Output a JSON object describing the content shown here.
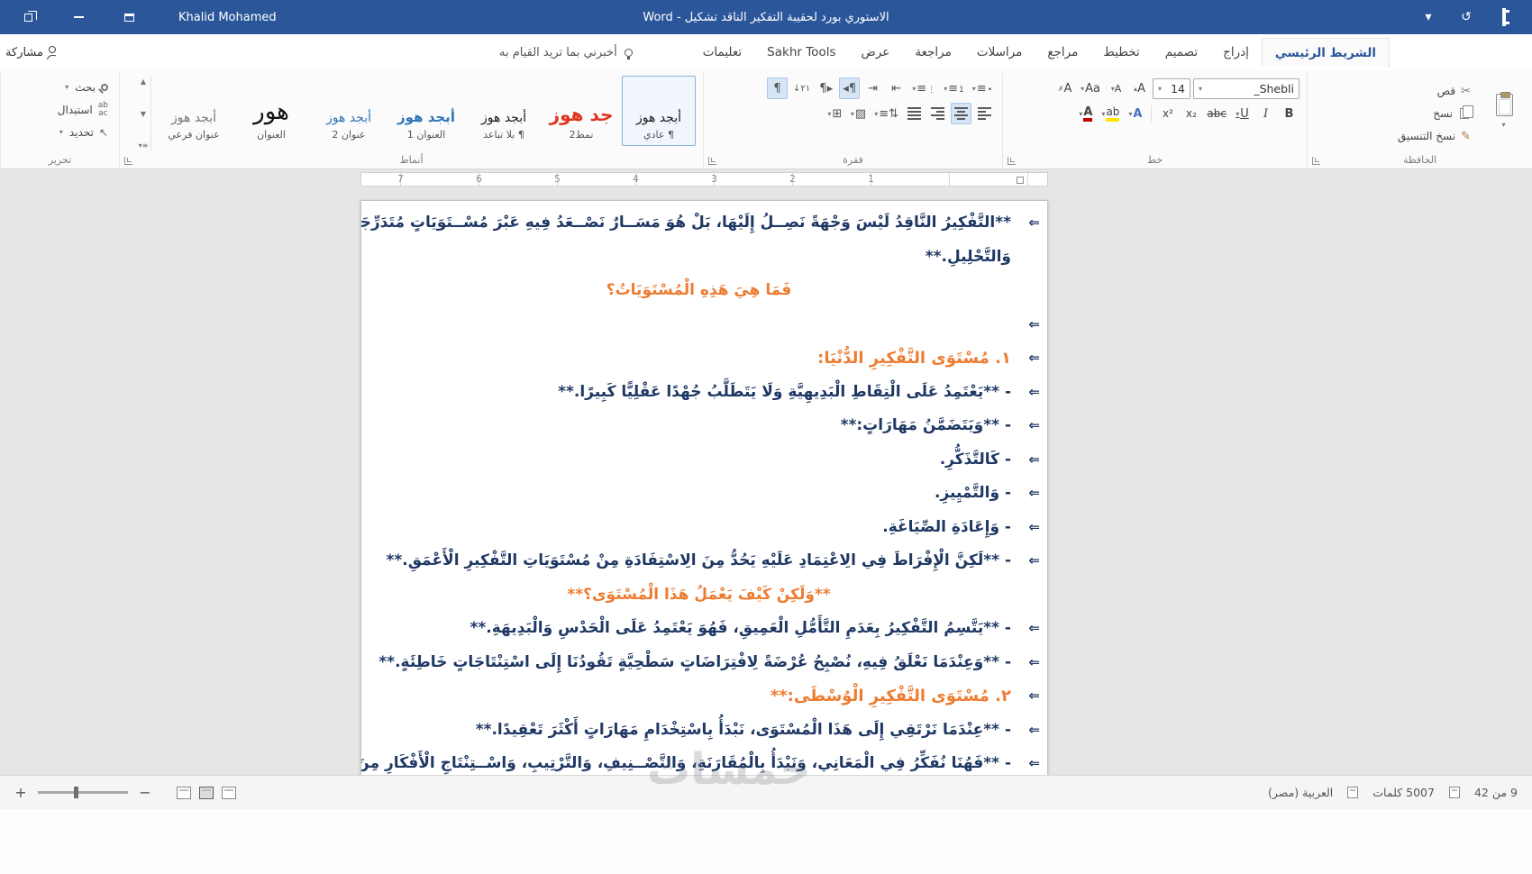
{
  "colors": {
    "titlebar": "#2b579a",
    "accent": "#2b579a",
    "heading_orange": "#ED7C31",
    "body_text": "#1F3864"
  },
  "titlebar": {
    "user_name": "Khalid Mohamed",
    "doc_title": "الاستوري بورد لحقيبة التفكير الناقد تشكيل - Word"
  },
  "tabs": {
    "share_label": "مشاركة",
    "tell_me": "أخبرني بما تريد القيام به",
    "items": [
      "الشريط الرئيسي",
      "إدراج",
      "تصميم",
      "تخطيط",
      "مراجع",
      "مراسلات",
      "مراجعة",
      "عرض",
      "Sakhr Tools",
      "تعليمات"
    ]
  },
  "ribbon": {
    "clipboard": {
      "label": "الحافظة",
      "cut": "قص",
      "copy": "نسخ",
      "format_painter": "نسخ التنسيق"
    },
    "font": {
      "label": "خط",
      "font_name": "_Shebli",
      "font_size": "14",
      "bold": "B",
      "italic": "I",
      "underline": "U",
      "strike": "abc",
      "subscript": "x₂",
      "superscript": "x²",
      "grow": "A",
      "shrink": "A",
      "change_case": "Aa",
      "clear": "A",
      "effects": "A",
      "highlight": "ab",
      "color": "A"
    },
    "paragraph": {
      "label": "فقرة"
    },
    "styles": {
      "label": "أنماط",
      "items": [
        {
          "preview": "أبجد هوز",
          "name": "¶ عادي"
        },
        {
          "preview": "جد هوز",
          "name": "نمط2"
        },
        {
          "preview": "أبجد هوز",
          "name": "¶ بلا تباعد"
        },
        {
          "preview": "أبجد هوز",
          "name": "العنوان 1"
        },
        {
          "preview": "أبجد هوز",
          "name": "عنوان 2"
        },
        {
          "preview": "هور",
          "name": "العنوان"
        },
        {
          "preview": "أبجد هوز",
          "name": "عنوان فرعي"
        }
      ]
    },
    "editing": {
      "label": "تحرير",
      "find": "بحث",
      "replace": "استبدال",
      "select": "تحديد"
    }
  },
  "ruler": {
    "numbers": [
      "7",
      "6",
      "5",
      "4",
      "3",
      "2",
      "1"
    ]
  },
  "doc": {
    "arrow": "⇐",
    "lines": [
      "**التَّفْكِيرُ النَّاقِدُ لَيْسَ وَجْهَةً نَصِــلُ إِلَيْهَا، بَلْ هُوَ مَسَــارٌ نَصْــعَدُ فِيهِ عَبْرَ مُسْــتَوَيَاتٍ مُتَدَرِّجَةٍ مِنَ الْفَهْمِ",
      "وَالتَّحْلِيلِ.**",
      "فَمَا هِيَ هَذِهِ الْمُسْتَوَيَاتُ؟",
      "",
      "١. مُسْتَوَى التَّفْكِيرِ الدُّنْيَا:",
      "- **يَعْتَمِدُ عَلَى الْتِقَاطِ الْبَدِيهِيَّةِ وَلَا يَتَطَلَّبُ جُهْدًا عَقْلِيًّا كَبِيرًا.**",
      "- **وَيَتَضَمَّنُ مَهَارَاتٍ:**",
      "- كَالتَّذَكُّرِ.",
      "- وَالتَّمْيِيزِ.",
      "- وَإِعَادَةِ الصِّيَاغَةِ.",
      "- **لَكِنَّ الْإِفْرَاطَ فِي الِاعْتِمَادِ عَلَيْهِ يَحُدُّ مِنَ الِاسْتِفَادَةِ مِنْ مُسْتَوَيَاتِ التَّفْكِيرِ الْأَعْمَقِ.**",
      "**وَلَكِنْ كَيْفَ يَعْمَلُ هَذَا الْمُسْتَوَى؟**",
      "- **يَتَّسِمُ التَّفْكِيرُ بِعَدَمِ التَّأَمُّلِ الْعَمِيقِ، فَهُوَ يَعْتَمِدُ عَلَى الْحَدْسِ وَالْبَدِيهَةِ.**",
      "- **وَعِنْدَمَا نَعْلَقُ فِيهِ، نُصْبِحُ عُرْضَةً لِافْتِرَاضَاتٍ سَطْحِيَّةٍ تَقُودُنَا إِلَى اسْتِنْتَاجَاتٍ خَاطِئَةٍ.**",
      "٢. مُسْتَوَى التَّفْكِيرِ الْوُسْطَى:**",
      "- **عِنْدَمَا نَرْتَقِي إِلَى هَذَا الْمُسْتَوَى، نَبْدَأُ بِاسْتِخْدَامِ مَهَارَاتٍ أَكْثَرَ تَعْقِيدًا.**",
      "- **فَهُنَا نُفَكِّرُ فِي الْمَعَانِي، وَنَبْدَأُ بِالْمُقَارَنَةِ، وَالتَّصْــنِيفِ، وَالتَّرْتِيبِ، وَاسْــتِنْتَاجِ الْأَفْكَارِ مِنَ الْمَوَاقِفِ"
    ]
  },
  "statusbar": {
    "page_info": "9 من 42",
    "word_count": "5007 كلمات",
    "language": "العربية (مصر)"
  },
  "watermark": "خمسات"
}
